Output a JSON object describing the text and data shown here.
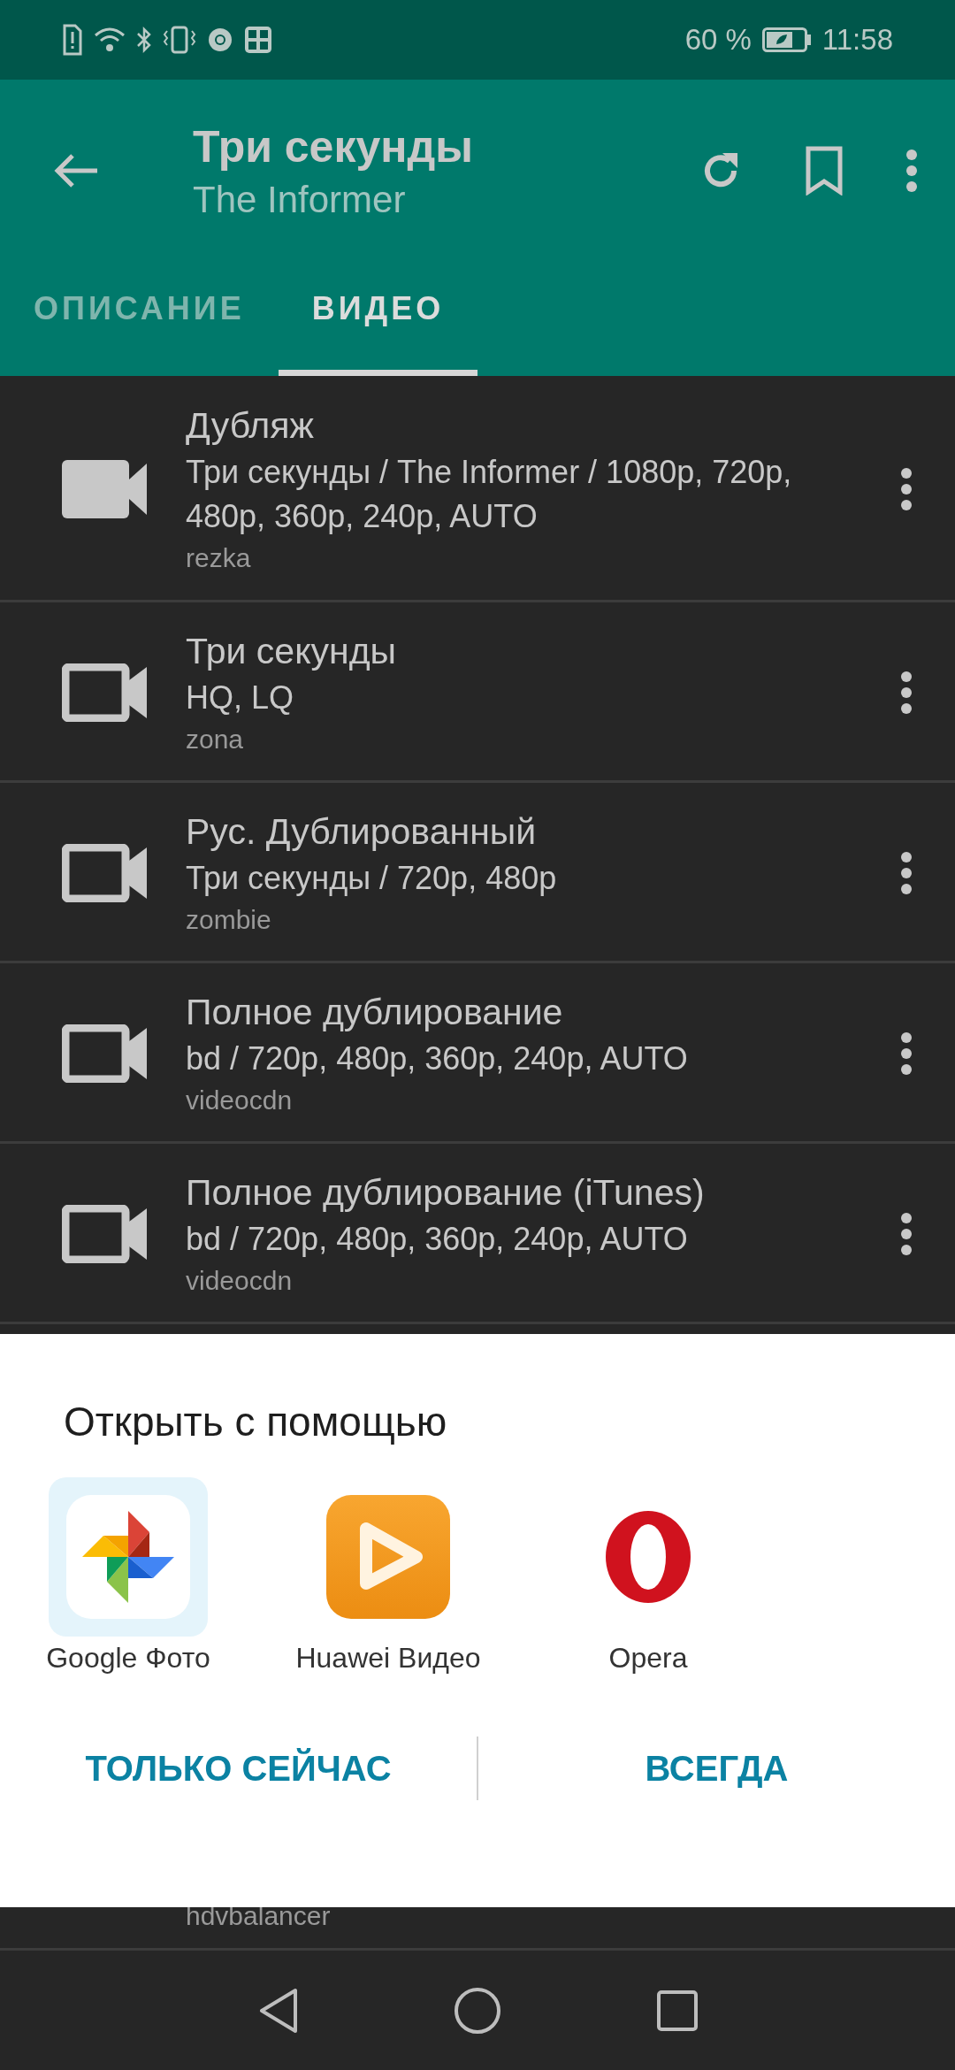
{
  "status_bar": {
    "battery": "60 %",
    "time": "11:58"
  },
  "app_bar": {
    "title": "Три секунды",
    "subtitle": "The Informer"
  },
  "tabs": [
    {
      "label": "ОПИСАНИЕ",
      "selected": false
    },
    {
      "label": "ВИДЕО",
      "selected": true
    }
  ],
  "videos": [
    {
      "title": "Дубляж",
      "details": "Три секунды / The Informer / 1080p, 720p, 480p, 360p, 240p, AUTO",
      "source": "rezka",
      "viewed": true
    },
    {
      "title": "Три секунды",
      "details": "HQ, LQ",
      "source": "zona",
      "viewed": false
    },
    {
      "title": "Рус. Дублированный",
      "details": "Три секунды / 720p, 480p",
      "source": "zombie",
      "viewed": false
    },
    {
      "title": "Полное дублирование",
      "details": "bd / 720p, 480p, 360p, 240p, AUTO",
      "source": "videocdn",
      "viewed": false
    },
    {
      "title": "Полное дублирование (iTunes)",
      "details": "bd / 720p, 480p, 360p, 240p, AUTO",
      "source": "videocdn",
      "viewed": false
    },
    {
      "source": "hdvbalancer"
    }
  ],
  "open_with_sheet": {
    "title": "Открыть с помощью",
    "apps": [
      {
        "label": "Google Фото",
        "kind": "pinwheel",
        "selected": true
      },
      {
        "label": "Huawei Видео",
        "kind": "play",
        "selected": false
      },
      {
        "label": "Opera",
        "kind": "ring",
        "selected": false
      }
    ],
    "buttons": [
      "ТОЛЬКО СЕЙЧАС",
      "ВСЕГДА"
    ]
  }
}
